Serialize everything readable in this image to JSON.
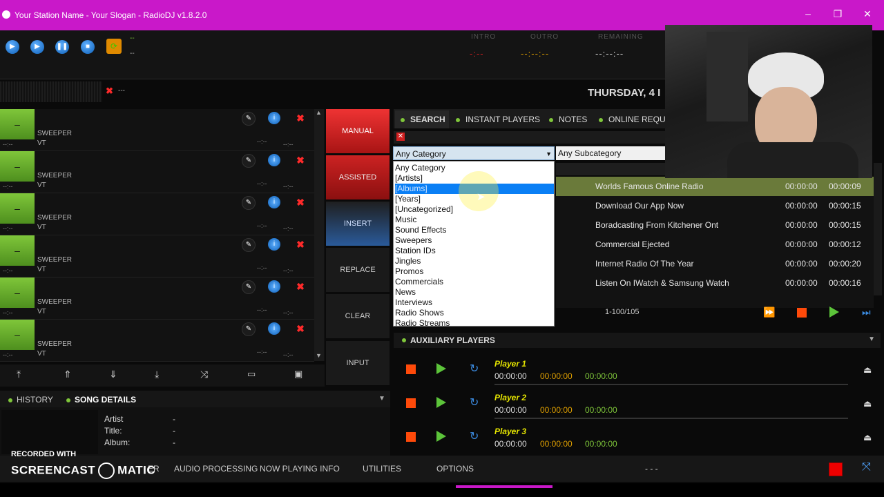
{
  "window": {
    "title": "Your Station Name - Your Slogan - RadioDJ v1.8.2.0"
  },
  "topbar": {
    "status_top": "--",
    "status_bottom": "--",
    "intro_label": "INTRO",
    "intro_value": "-:--",
    "outro_label": "OUTRO",
    "outro_value": "--:--:--",
    "remaining_label": "REMAINING",
    "remaining_value": "--:--:--",
    "date": "THURSDAY, 4 I",
    "meter_text": "---"
  },
  "carts": [
    {
      "label": "–",
      "type": "SWEEPER",
      "sub": "VT",
      "time": "--:--",
      "t2": "--:--",
      "t3": "--:--"
    },
    {
      "label": "–",
      "type": "SWEEPER",
      "sub": "VT",
      "time": "--:--",
      "t2": "--:--",
      "t3": "--:--"
    },
    {
      "label": "–",
      "type": "SWEEPER",
      "sub": "VT",
      "time": "--:--",
      "t2": "--:--",
      "t3": "--:--"
    },
    {
      "label": "–",
      "type": "SWEEPER",
      "sub": "VT",
      "time": "--:--",
      "t2": "--:--",
      "t3": "--:--"
    },
    {
      "label": "–",
      "type": "SWEEPER",
      "sub": "VT",
      "time": "--:--",
      "t2": "--:--",
      "t3": "--:--"
    },
    {
      "label": "–",
      "type": "SWEEPER",
      "sub": "VT",
      "time": "--:--",
      "t2": "--:--",
      "t3": "--:--"
    }
  ],
  "modes": {
    "manual": "MANUAL",
    "assisted": "ASSISTED",
    "insert": "INSERT",
    "replace": "REPLACE",
    "clear": "CLEAR",
    "input": "INPUT"
  },
  "tabs": {
    "search": "SEARCH",
    "instant": "INSTANT PLAYERS",
    "notes": "NOTES",
    "online": "ONLINE REQUES"
  },
  "search": {
    "category": "Any Category",
    "subcategory": "Any Subcategory",
    "options": [
      "Any Category",
      "[Artists]",
      "[Albums]",
      "[Years]",
      "[Uncategorized]",
      "Music",
      "Sound Effects",
      "Sweepers",
      "Station IDs",
      "Jingles",
      "Promos",
      "Commercials",
      "News",
      "Interviews",
      "Radio Shows",
      "Radio Streams"
    ],
    "selected_index": 2
  },
  "results": [
    {
      "name": "Worlds Famous Online Radio",
      "d1": "00:00:00",
      "d2": "00:00:09"
    },
    {
      "name": "Download Our App Now",
      "d1": "00:00:00",
      "d2": "00:00:15"
    },
    {
      "name": "Boradcasting From Kitchener Ont",
      "d1": "00:00:00",
      "d2": "00:00:15"
    },
    {
      "name": "Commercial Ejected",
      "d1": "00:00:00",
      "d2": "00:00:12"
    },
    {
      "name": "Internet Radio Of The Year",
      "d1": "00:00:00",
      "d2": "00:00:20"
    },
    {
      "name": "Listen On IWatch & Samsung Watch",
      "d1": "00:00:00",
      "d2": "00:00:16"
    }
  ],
  "pager": "1-100/105",
  "aux": {
    "title": "AUXILIARY PLAYERS",
    "players": [
      {
        "name": "Player 1",
        "t1": "00:00:00",
        "t2": "00:00:00",
        "t3": "00:00:00"
      },
      {
        "name": "Player 2",
        "t1": "00:00:00",
        "t2": "00:00:00",
        "t3": "00:00:00"
      },
      {
        "name": "Player 3",
        "t1": "00:00:00",
        "t2": "00:00:00",
        "t3": "00:00:00"
      }
    ]
  },
  "lower": {
    "history": "HISTORY",
    "song_details": "SONG DETAILS",
    "artist_label": "Artist",
    "title_label": "Title:",
    "album_label": "Album:",
    "artist_value": "-",
    "title_value": "-",
    "album_value": "-"
  },
  "bottom_tabs": {
    "audio": "AUDIO PROCESSING",
    "nowplaying": "NOW PLAYING INFO",
    "utilities": "UTILITIES",
    "options": "OPTIONS",
    "status": "- - -",
    "partial": "ER"
  },
  "watermark": {
    "line1": "RECORDED WITH",
    "line2": "SCREENCAST",
    "line3": "MATIC"
  }
}
